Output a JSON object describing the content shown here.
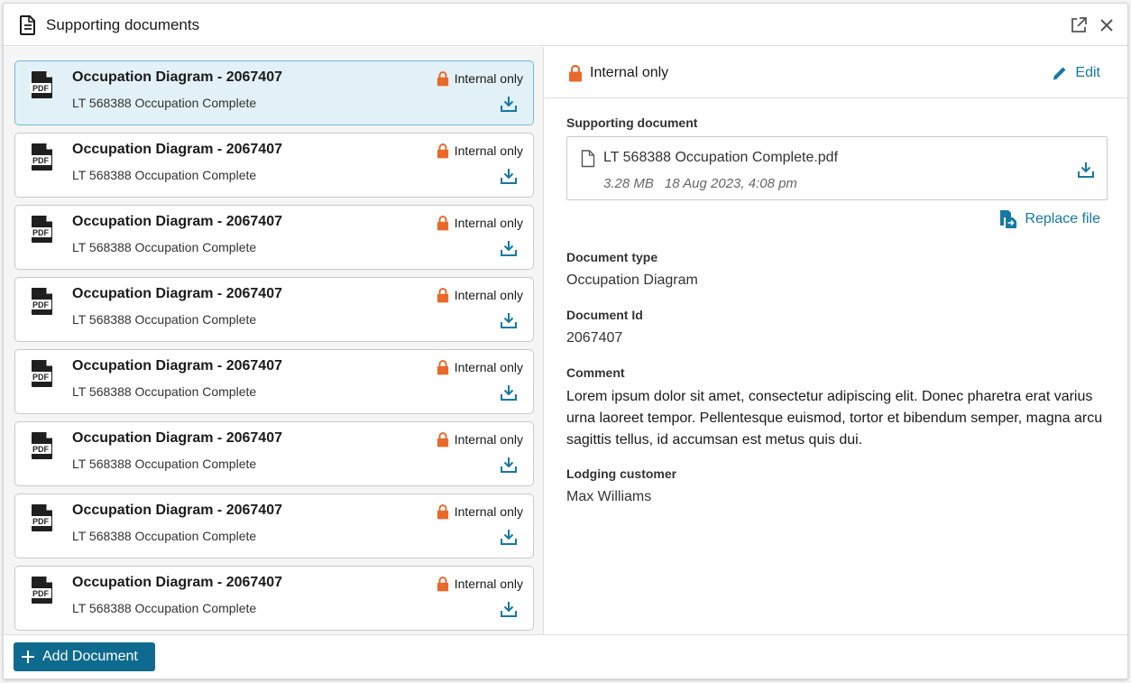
{
  "header": {
    "title": "Supporting documents"
  },
  "documents": [
    {
      "title": "Occupation Diagram - 2067407",
      "subtitle": "LT 568388 Occupation Complete",
      "badge": "Internal only",
      "selected": true
    },
    {
      "title": "Occupation Diagram - 2067407",
      "subtitle": "LT 568388 Occupation Complete",
      "badge": "Internal only"
    },
    {
      "title": "Occupation Diagram - 2067407",
      "subtitle": "LT 568388 Occupation Complete",
      "badge": "Internal only"
    },
    {
      "title": "Occupation Diagram - 2067407",
      "subtitle": "LT 568388 Occupation Complete",
      "badge": "Internal only"
    },
    {
      "title": "Occupation Diagram - 2067407",
      "subtitle": "LT 568388 Occupation Complete",
      "badge": "Internal only"
    },
    {
      "title": "Occupation Diagram - 2067407",
      "subtitle": "LT 568388 Occupation Complete",
      "badge": "Internal only"
    },
    {
      "title": "Occupation Diagram - 2067407",
      "subtitle": "LT 568388 Occupation Complete",
      "badge": "Internal only"
    },
    {
      "title": "Occupation Diagram - 2067407",
      "subtitle": "LT 568388 Occupation Complete",
      "badge": "Internal only"
    }
  ],
  "icons": {
    "pdf": "pdf-file-icon",
    "lock": "lock-icon",
    "download": "download-icon"
  },
  "footer": {
    "add_label": "Add Document"
  },
  "detail": {
    "badge": "Internal only",
    "edit_label": "Edit",
    "supporting_label": "Supporting document",
    "file": {
      "name": "LT 568388 Occupation Complete.pdf",
      "size": "3.28 MB",
      "date": "18 Aug 2023, 4:08 pm"
    },
    "replace_label": "Replace file",
    "doc_type_label": "Document type",
    "doc_type_value": "Occupation Diagram",
    "doc_id_label": "Document Id",
    "doc_id_value": "2067407",
    "comment_label": "Comment",
    "comment_value": "Lorem ipsum dolor sit amet, consectetur adipiscing elit. Donec pharetra erat varius urna laoreet tempor. Pellentesque euismod, tortor et bibendum semper, magna arcu sagittis tellus, id accumsan est metus quis dui.",
    "customer_label": "Lodging customer",
    "customer_value": "Max Williams"
  },
  "colors": {
    "accent": "#1579a3",
    "primary_button": "#0e6a8e",
    "lock": "#e8692a",
    "selected_bg": "#e2f1f7"
  }
}
